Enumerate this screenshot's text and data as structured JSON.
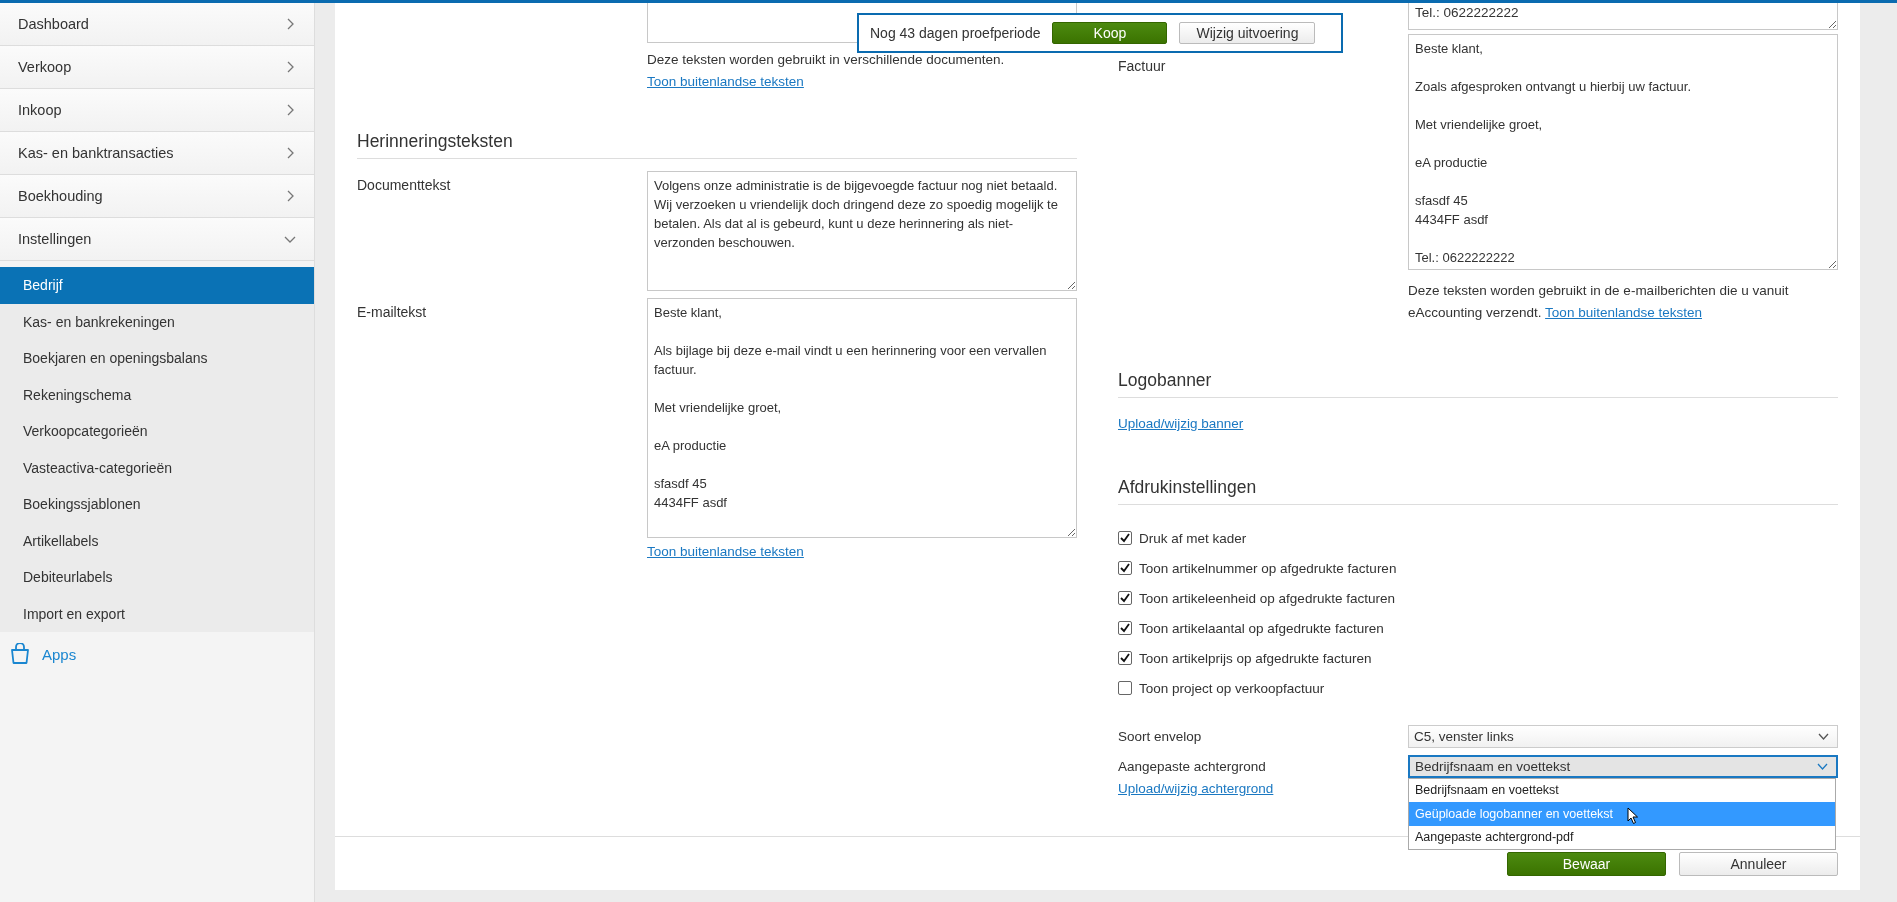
{
  "sidebar": {
    "items": [
      {
        "label": "Dashboard",
        "expanded": false
      },
      {
        "label": "Verkoop",
        "expanded": false
      },
      {
        "label": "Inkoop",
        "expanded": false
      },
      {
        "label": "Kas- en banktransacties",
        "expanded": false
      },
      {
        "label": "Boekhouding",
        "expanded": false
      },
      {
        "label": "Instellingen",
        "expanded": true,
        "children": [
          {
            "label": "Bedrijf",
            "selected": true
          },
          {
            "label": "Kas- en bankrekeningen",
            "selected": false
          },
          {
            "label": "Boekjaren en openingsbalans",
            "selected": false
          },
          {
            "label": "Rekeningschema",
            "selected": false
          },
          {
            "label": "Verkoopcategorieën",
            "selected": false
          },
          {
            "label": "Vasteactiva-categorieën",
            "selected": false
          },
          {
            "label": "Boekingssjablonen",
            "selected": false
          },
          {
            "label": "Artikellabels",
            "selected": false
          },
          {
            "label": "Debiteurlabels",
            "selected": false
          },
          {
            "label": "Import en export",
            "selected": false
          }
        ]
      }
    ],
    "apps": {
      "label": "Apps"
    }
  },
  "trial_banner": {
    "text": "Nog 43 dagen proefperiode",
    "buy": "Koop",
    "change": "Wijzig uitvoering"
  },
  "left_column": {
    "note": {
      "text": "Deze teksten worden gebruikt in verschillende documenten.",
      "link": "Toon buitenlandse teksten"
    },
    "reminder_section": {
      "title": "Herinneringsteksten",
      "fields": [
        {
          "label": "Documenttekst",
          "value": "Volgens onze administratie is de bijgevoegde factuur nog niet betaald. Wij verzoeken u vriendelijk doch dringend deze zo spoedig mogelijk te betalen. Als dat al is gebeurd, kunt u deze herinnering als niet-verzonden beschouwen."
        },
        {
          "label": "E-mailtekst",
          "value": "Beste klant,\n\nAls bijlage bij deze e-mail vindt u een herinnering voor een vervallen factuur.\n\nMet vriendelijke groet,\n\neA productie\n\nsfasdf 45\n4434FF asdf"
        }
      ],
      "link": "Toon buitenlandse teksten"
    }
  },
  "right_column": {
    "top_field": {
      "value": "Tel.: 0622222222"
    },
    "invoice_field": {
      "label": "Factuur",
      "value": "Beste klant,\n\nZoals afgesproken ontvangt u hierbij uw factuur.\n\nMet vriendelijke groet,\n\neA productie\n\nsfasdf 45\n4434FF asdf\n\nTel.: 0622222222"
    },
    "note": {
      "text": "Deze teksten worden gebruikt in de e-mailberichten die u vanuit eAccounting verzendt.",
      "link": "Toon buitenlandse teksten"
    },
    "logobanner": {
      "title": "Logobanner",
      "link": "Upload/wijzig banner"
    },
    "print_settings": {
      "title": "Afdrukinstellingen",
      "checkboxes": [
        {
          "label": "Druk af met kader",
          "checked": true
        },
        {
          "label": "Toon artikelnummer op afgedrukte facturen",
          "checked": true
        },
        {
          "label": "Toon artikeleenheid op afgedrukte facturen",
          "checked": true
        },
        {
          "label": "Toon artikelaantal op afgedrukte facturen",
          "checked": true
        },
        {
          "label": "Toon artikelprijs op afgedrukte facturen",
          "checked": true
        },
        {
          "label": "Toon project op verkoopfactuur",
          "checked": false
        }
      ],
      "selects": [
        {
          "label": "Soort envelop",
          "value": "C5, venster links",
          "open": false
        },
        {
          "label": "Aangepaste achtergrond",
          "value": "Bedrijfsnaam en voettekst",
          "open": true,
          "options": [
            {
              "label": "Bedrijfsnaam en voettekst",
              "highlighted": false
            },
            {
              "label": "Geüploade logobanner en voettekst",
              "highlighted": true
            },
            {
              "label": "Aangepaste achtergrond-pdf",
              "highlighted": false
            }
          ]
        }
      ],
      "link": "Upload/wijzig achtergrond"
    }
  },
  "footer": {
    "buttons": [
      {
        "label": "Bewaar",
        "kind": "primary"
      },
      {
        "label": "Annuleer",
        "kind": "secondary"
      }
    ]
  }
}
